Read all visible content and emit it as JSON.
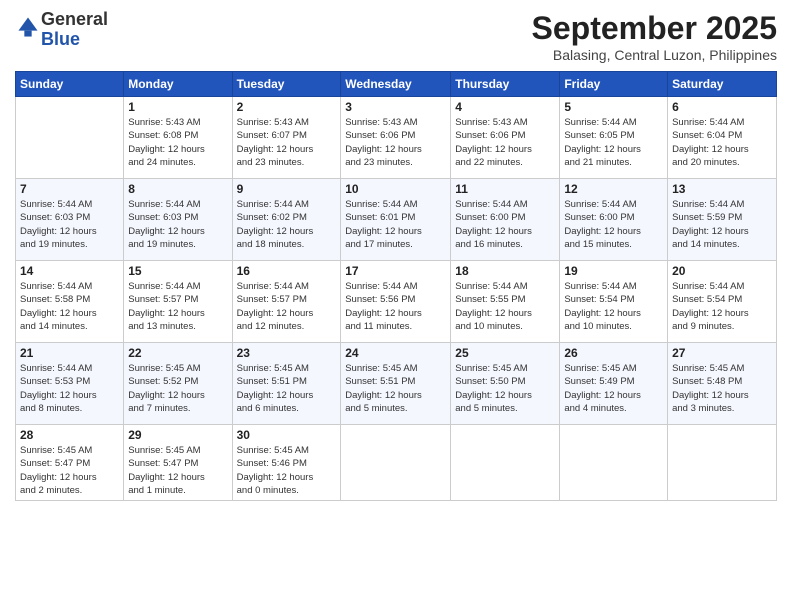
{
  "header": {
    "logo": {
      "line1": "General",
      "line2": "Blue"
    },
    "title": "September 2025",
    "location": "Balasing, Central Luzon, Philippines"
  },
  "weekdays": [
    "Sunday",
    "Monday",
    "Tuesday",
    "Wednesday",
    "Thursday",
    "Friday",
    "Saturday"
  ],
  "weeks": [
    [
      {
        "day": "",
        "info": ""
      },
      {
        "day": "1",
        "info": "Sunrise: 5:43 AM\nSunset: 6:08 PM\nDaylight: 12 hours\nand 24 minutes."
      },
      {
        "day": "2",
        "info": "Sunrise: 5:43 AM\nSunset: 6:07 PM\nDaylight: 12 hours\nand 23 minutes."
      },
      {
        "day": "3",
        "info": "Sunrise: 5:43 AM\nSunset: 6:06 PM\nDaylight: 12 hours\nand 23 minutes."
      },
      {
        "day": "4",
        "info": "Sunrise: 5:43 AM\nSunset: 6:06 PM\nDaylight: 12 hours\nand 22 minutes."
      },
      {
        "day": "5",
        "info": "Sunrise: 5:44 AM\nSunset: 6:05 PM\nDaylight: 12 hours\nand 21 minutes."
      },
      {
        "day": "6",
        "info": "Sunrise: 5:44 AM\nSunset: 6:04 PM\nDaylight: 12 hours\nand 20 minutes."
      }
    ],
    [
      {
        "day": "7",
        "info": "Sunrise: 5:44 AM\nSunset: 6:03 PM\nDaylight: 12 hours\nand 19 minutes."
      },
      {
        "day": "8",
        "info": "Sunrise: 5:44 AM\nSunset: 6:03 PM\nDaylight: 12 hours\nand 19 minutes."
      },
      {
        "day": "9",
        "info": "Sunrise: 5:44 AM\nSunset: 6:02 PM\nDaylight: 12 hours\nand 18 minutes."
      },
      {
        "day": "10",
        "info": "Sunrise: 5:44 AM\nSunset: 6:01 PM\nDaylight: 12 hours\nand 17 minutes."
      },
      {
        "day": "11",
        "info": "Sunrise: 5:44 AM\nSunset: 6:00 PM\nDaylight: 12 hours\nand 16 minutes."
      },
      {
        "day": "12",
        "info": "Sunrise: 5:44 AM\nSunset: 6:00 PM\nDaylight: 12 hours\nand 15 minutes."
      },
      {
        "day": "13",
        "info": "Sunrise: 5:44 AM\nSunset: 5:59 PM\nDaylight: 12 hours\nand 14 minutes."
      }
    ],
    [
      {
        "day": "14",
        "info": "Sunrise: 5:44 AM\nSunset: 5:58 PM\nDaylight: 12 hours\nand 14 minutes."
      },
      {
        "day": "15",
        "info": "Sunrise: 5:44 AM\nSunset: 5:57 PM\nDaylight: 12 hours\nand 13 minutes."
      },
      {
        "day": "16",
        "info": "Sunrise: 5:44 AM\nSunset: 5:57 PM\nDaylight: 12 hours\nand 12 minutes."
      },
      {
        "day": "17",
        "info": "Sunrise: 5:44 AM\nSunset: 5:56 PM\nDaylight: 12 hours\nand 11 minutes."
      },
      {
        "day": "18",
        "info": "Sunrise: 5:44 AM\nSunset: 5:55 PM\nDaylight: 12 hours\nand 10 minutes."
      },
      {
        "day": "19",
        "info": "Sunrise: 5:44 AM\nSunset: 5:54 PM\nDaylight: 12 hours\nand 10 minutes."
      },
      {
        "day": "20",
        "info": "Sunrise: 5:44 AM\nSunset: 5:54 PM\nDaylight: 12 hours\nand 9 minutes."
      }
    ],
    [
      {
        "day": "21",
        "info": "Sunrise: 5:44 AM\nSunset: 5:53 PM\nDaylight: 12 hours\nand 8 minutes."
      },
      {
        "day": "22",
        "info": "Sunrise: 5:45 AM\nSunset: 5:52 PM\nDaylight: 12 hours\nand 7 minutes."
      },
      {
        "day": "23",
        "info": "Sunrise: 5:45 AM\nSunset: 5:51 PM\nDaylight: 12 hours\nand 6 minutes."
      },
      {
        "day": "24",
        "info": "Sunrise: 5:45 AM\nSunset: 5:51 PM\nDaylight: 12 hours\nand 5 minutes."
      },
      {
        "day": "25",
        "info": "Sunrise: 5:45 AM\nSunset: 5:50 PM\nDaylight: 12 hours\nand 5 minutes."
      },
      {
        "day": "26",
        "info": "Sunrise: 5:45 AM\nSunset: 5:49 PM\nDaylight: 12 hours\nand 4 minutes."
      },
      {
        "day": "27",
        "info": "Sunrise: 5:45 AM\nSunset: 5:48 PM\nDaylight: 12 hours\nand 3 minutes."
      }
    ],
    [
      {
        "day": "28",
        "info": "Sunrise: 5:45 AM\nSunset: 5:47 PM\nDaylight: 12 hours\nand 2 minutes."
      },
      {
        "day": "29",
        "info": "Sunrise: 5:45 AM\nSunset: 5:47 PM\nDaylight: 12 hours\nand 1 minute."
      },
      {
        "day": "30",
        "info": "Sunrise: 5:45 AM\nSunset: 5:46 PM\nDaylight: 12 hours\nand 0 minutes."
      },
      {
        "day": "",
        "info": ""
      },
      {
        "day": "",
        "info": ""
      },
      {
        "day": "",
        "info": ""
      },
      {
        "day": "",
        "info": ""
      }
    ]
  ]
}
